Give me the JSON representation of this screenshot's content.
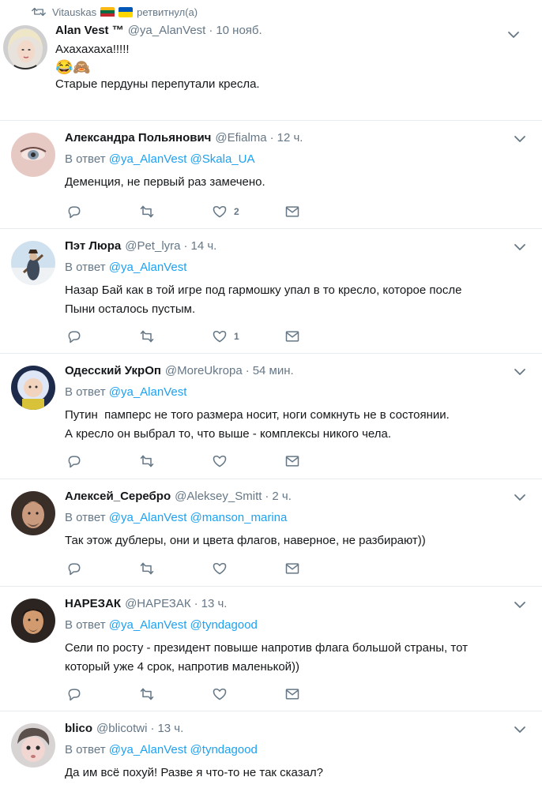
{
  "retweet": {
    "user": "Vitauskas",
    "text": "ретвитнул(а)"
  },
  "main_tweet": {
    "name": "Alan Vest ™",
    "handle": "@ya_AlanVest",
    "time": "10 нояб.",
    "line1": "Ахахахаха!!!!!",
    "emoji": "😂🙈",
    "line3": "Старые пердуны перепутали кресла."
  },
  "in_reply_prefix": "В ответ",
  "replies": [
    {
      "name": "Александра Польянович",
      "handle": "@Efialma",
      "time": "12 ч.",
      "mention1": "@ya_AlanVest",
      "mention2": "@Skala_UA",
      "line1": "Деменция, не первый раз замечено.",
      "line2": "",
      "likes": "2"
    },
    {
      "name": "Пэт Люра",
      "handle": "@Pet_lyra",
      "time": "14 ч.",
      "mention1": "@ya_AlanVest",
      "mention2": "",
      "line1": "Назар Бай как в той игре под гармошку упал в то кресло, которое после",
      "line2": "Пыни осталось пустым.",
      "likes": "1"
    },
    {
      "name": "Одесский УкрОп",
      "handle": "@MoreUkropa",
      "time": "54 мин.",
      "mention1": "@ya_AlanVest",
      "mention2": "",
      "line1": "Путин  памперс не того размера носит, ноги сомкнуть не в состоянии.",
      "line2": "А кресло он выбрал то, что выше - комплексы никого чела.",
      "likes": ""
    },
    {
      "name": "Алексей_Серебро",
      "handle": "@Aleksey_Smitt",
      "time": "2 ч.",
      "mention1": "@ya_AlanVest",
      "mention2": "@manson_marina",
      "line1": "Так этож дублеры, они и цвета флагов, наверное, не разбирают))",
      "line2": "",
      "likes": ""
    },
    {
      "name": "НАРЕЗАК",
      "handle": "@НАРЕЗАК",
      "time": "13 ч.",
      "mention1": "@ya_AlanVest",
      "mention2": "@tyndagood",
      "line1": "Сели по росту - президент повыше напротив флага большой страны, тот",
      "line2": "который уже 4 срок, напротив маленькой))",
      "likes": ""
    },
    {
      "name": "blico",
      "handle": "@blicotwi",
      "time": "13 ч.",
      "mention1": "@ya_AlanVest",
      "mention2": "@tyndagood",
      "line1": "Да им всё похуй! Разве я что-то не так сказал?",
      "line2": "",
      "likes": ""
    }
  ],
  "colors": {
    "accent": "#1da1f2",
    "muted": "#657786",
    "border": "#e6ecf0"
  },
  "icons": [
    "retweet-icon",
    "chevron-down-icon",
    "reply-icon",
    "like-icon",
    "message-icon"
  ]
}
